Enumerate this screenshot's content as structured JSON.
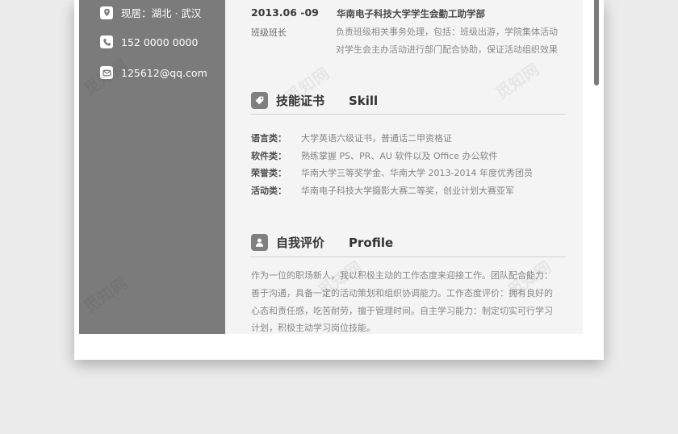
{
  "contacts": [
    {
      "icon": "location-pin-icon",
      "text": "现居：湖北 · 武汉"
    },
    {
      "icon": "phone-icon",
      "text": "152 0000 0000"
    },
    {
      "icon": "mail-icon",
      "text": "125612@qq.com"
    }
  ],
  "experience": {
    "date": "2013.06 -09",
    "org": "华南电子科技大学学生会勤工助学部",
    "role": "班级班长",
    "duties": [
      "负责班级相关事务处理，包括：班级出游，学院集体活动",
      "对学生会主办活动进行部门配合协助，保证活动组织效果"
    ]
  },
  "skills": {
    "title_cn": "技能证书",
    "title_en": "Skill",
    "icon": "skill-tag-icon",
    "items": [
      {
        "key": "语言类：",
        "value": "大学英语六级证书，普通话二甲资格证"
      },
      {
        "key": "软件类：",
        "value": "熟练掌握 PS、PR、AU 软件以及 Office 办公软件"
      },
      {
        "key": "荣誉类：",
        "value": "华南大学三等奖学金、华南大学 2013-2014 年度优秀团员"
      },
      {
        "key": "活动类：",
        "value": "华南电子科技大学摄影大赛二等奖，创业计划大赛亚军"
      }
    ]
  },
  "profile": {
    "title_cn": "自我评价",
    "title_en": "Profile",
    "icon": "person-icon",
    "lines": [
      "作为一位的职场新人，我以积极主动的工作态度来迎接工作。团队配合能力：",
      "善于沟通，具备一定的活动策划和组织协调能力。工作态度评价：拥有良好的",
      "心态和责任感，吃苦耐劳，擅于管理时间。自主学习能力：制定切实可行学习",
      "计划，积极主动学习岗位技能。"
    ]
  },
  "watermark": "觅知网",
  "colors": {
    "sidebar": "#7b7b7b",
    "sheet": "#f4f4f4",
    "background": "#ececec",
    "icon_box": "#7f7f7f"
  }
}
